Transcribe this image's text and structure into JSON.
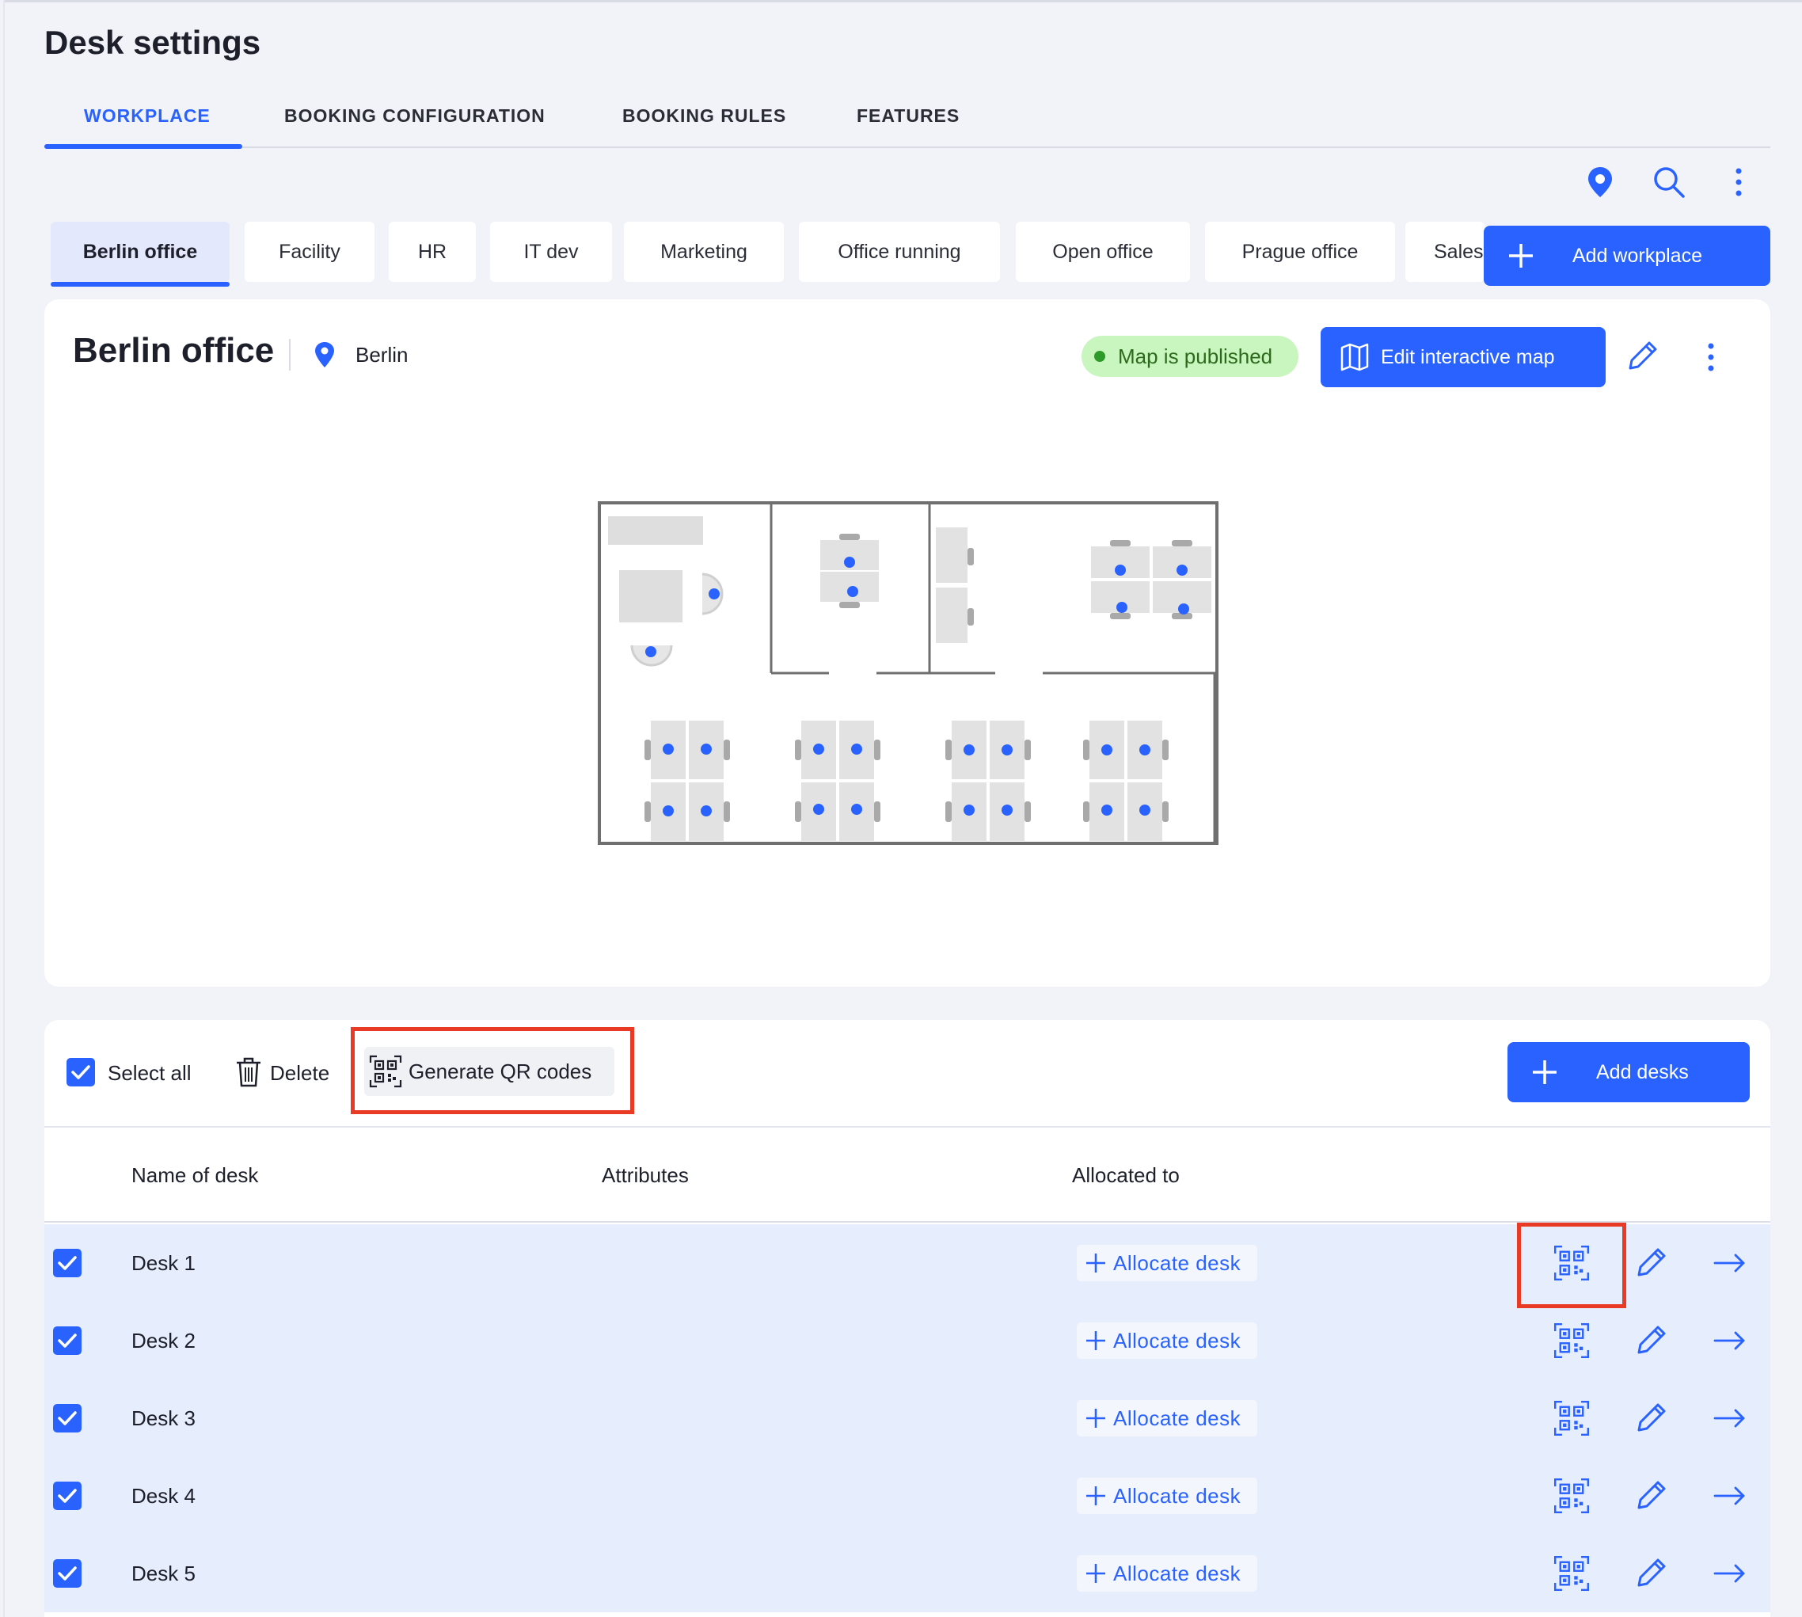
{
  "page": {
    "title": "Desk settings"
  },
  "main_tabs": [
    {
      "label": "WORKPLACE",
      "active": true
    },
    {
      "label": "BOOKING CONFIGURATION",
      "active": false
    },
    {
      "label": "BOOKING RULES",
      "active": false
    },
    {
      "label": "FEATURES",
      "active": false
    }
  ],
  "workplace_tabs": [
    {
      "label": "Berlin office",
      "active": true
    },
    {
      "label": "Facility"
    },
    {
      "label": "HR"
    },
    {
      "label": "IT dev"
    },
    {
      "label": "Marketing"
    },
    {
      "label": "Office running"
    },
    {
      "label": "Open office"
    },
    {
      "label": "Prague office"
    },
    {
      "label": "Sales"
    }
  ],
  "add_workplace_label": "Add workplace",
  "office": {
    "name": "Berlin office",
    "city": "Berlin",
    "map_status": "Map is published",
    "edit_map_label": "Edit interactive map"
  },
  "desks_toolbar": {
    "select_all_label": "Select all",
    "delete_label": "Delete",
    "generate_qr_label": "Generate QR codes",
    "add_desks_label": "Add desks"
  },
  "table": {
    "headers": {
      "name": "Name of desk",
      "attributes": "Attributes",
      "allocated": "Allocated to"
    },
    "allocate_label": "Allocate desk",
    "rows": [
      {
        "name": "Desk 1",
        "checked": true
      },
      {
        "name": "Desk 2",
        "checked": true
      },
      {
        "name": "Desk 3",
        "checked": true
      },
      {
        "name": "Desk 4",
        "checked": true
      },
      {
        "name": "Desk 5",
        "checked": true
      }
    ]
  },
  "colors": {
    "accent": "#2962ff",
    "published_bg": "#c9f6bf",
    "highlight": "#e83a24",
    "row_selected": "#e6edfc"
  },
  "icons": [
    "map-pin-icon",
    "search-icon",
    "more-vertical-icon",
    "plus-icon",
    "map-icon",
    "pencil-icon",
    "trash-icon",
    "qr-code-icon",
    "arrow-right-icon",
    "check-icon"
  ]
}
